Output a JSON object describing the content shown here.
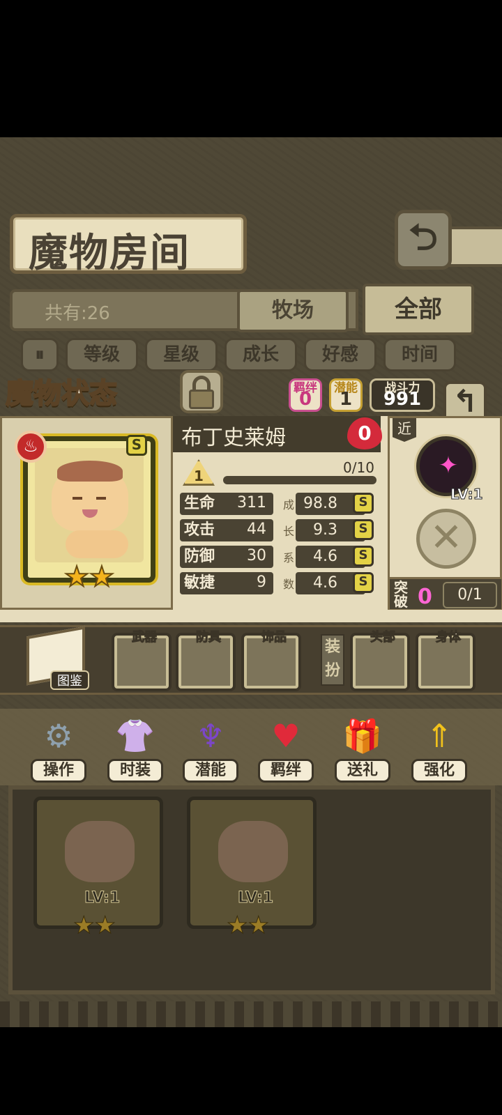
{
  "header": {
    "title": "魔物房间",
    "back_icon": "back-arrow-icon"
  },
  "filter": {
    "count": "共有:26",
    "tabs": [
      {
        "label": "牧场"
      },
      {
        "label": "全部"
      }
    ]
  },
  "sort": {
    "toggle_icon": "pause-icon",
    "buttons": [
      "等级",
      "星级",
      "成长",
      "好感",
      "时间"
    ]
  },
  "status_panel": {
    "title": "魔物状态",
    "lock_icon": "padlock-icon",
    "bond": {
      "label": "羁绊",
      "value": "0"
    },
    "potential": {
      "label": "潜能",
      "value": "1"
    },
    "power": {
      "label": "战斗力",
      "value": "991"
    },
    "return_icon": "return-arrow-icon"
  },
  "monster": {
    "name": "布丁史莱姆",
    "affection": "0",
    "element_icon": "fire-icon",
    "rank": "S",
    "stars": "★★",
    "level": "1",
    "exp": "0/10",
    "exp_ratio": 0.0,
    "growth_label": "成长系数",
    "stats": [
      {
        "name": "生命",
        "value": "311",
        "growth": "98.8",
        "grade": "S"
      },
      {
        "name": "攻击",
        "value": "44",
        "growth": "9.3",
        "grade": "S"
      },
      {
        "name": "防御",
        "value": "30",
        "growth": "4.6",
        "grade": "S"
      },
      {
        "name": "敏捷",
        "value": "9",
        "growth": "4.6",
        "grade": "S"
      }
    ],
    "range": "近",
    "skill_level": "LV:1",
    "breakthrough": {
      "label": "突破",
      "value": "0",
      "progress": "0/1"
    }
  },
  "equipment": {
    "book_label": "图鉴",
    "slots": [
      "武器",
      "防具",
      "饰品",
      "头部",
      "身体"
    ],
    "dress_label": "装扮"
  },
  "actions": [
    {
      "label": "操作",
      "icon": "gear-icon"
    },
    {
      "label": "时装",
      "icon": "clothes-icon"
    },
    {
      "label": "潜能",
      "icon": "demon-icon"
    },
    {
      "label": "羁绊",
      "icon": "hearts-icon"
    },
    {
      "label": "送礼",
      "icon": "gift-icon"
    },
    {
      "label": "强化",
      "icon": "up-arrows-icon"
    }
  ],
  "list": [
    {
      "level": "LV:1",
      "stars": "★★"
    },
    {
      "level": "LV:1",
      "stars": "★★"
    }
  ],
  "colors": {
    "accent_gold": "#e3d246",
    "bond_pink": "#c8377e",
    "heart_red": "#d42a3b"
  }
}
